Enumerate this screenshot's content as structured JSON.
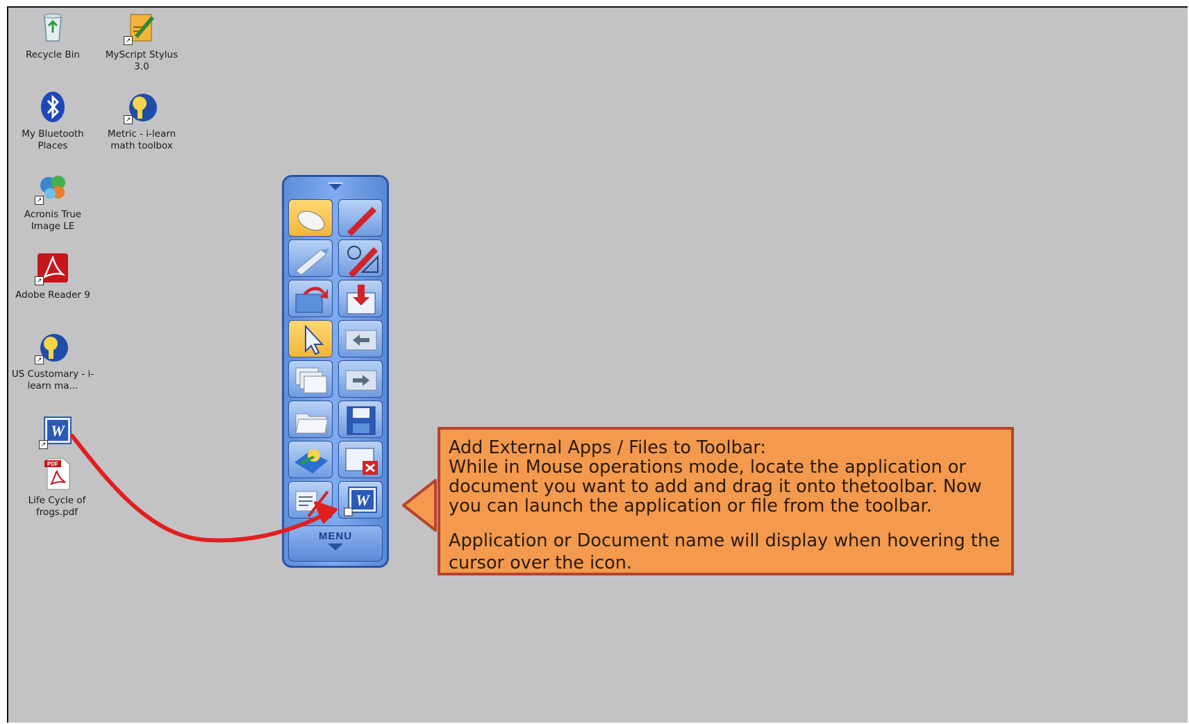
{
  "desktop": {
    "icons": [
      {
        "label": "Recycle Bin",
        "icon": "recycle-bin-icon"
      },
      {
        "label": "MyScript Stylus 3.0",
        "icon": "myscript-stylus-icon"
      },
      {
        "label": "My Bluetooth Places",
        "icon": "bluetooth-icon"
      },
      {
        "label": "Metric - i-learn math toolbox",
        "icon": "ilearn-math-icon"
      },
      {
        "label": "Acronis True Image LE",
        "icon": "acronis-icon"
      },
      {
        "label": "Adobe Reader 9",
        "icon": "adobe-reader-icon"
      },
      {
        "label": "US Customary - i-learn ma...",
        "icon": "ilearn-math-icon"
      },
      {
        "label": "",
        "icon": "word-document-icon"
      },
      {
        "label": "Life Cycle of frogs.pdf",
        "icon": "pdf-file-icon"
      }
    ]
  },
  "toolbar": {
    "menu_label": "MENU",
    "buttons": [
      {
        "icon": "mouse-icon"
      },
      {
        "icon": "pen-icon"
      },
      {
        "icon": "highlighter-icon"
      },
      {
        "icon": "pen-shape-icon"
      },
      {
        "icon": "open-file-icon"
      },
      {
        "icon": "import-icon"
      },
      {
        "icon": "pointer-icon"
      },
      {
        "icon": "back-arrow-icon"
      },
      {
        "icon": "pages-icon"
      },
      {
        "icon": "forward-arrow-icon"
      },
      {
        "icon": "folder-icon"
      },
      {
        "icon": "save-icon"
      },
      {
        "icon": "app-icon"
      },
      {
        "icon": "close-window-icon"
      },
      {
        "icon": "eraser-icon"
      },
      {
        "icon": "word-shortcut-icon"
      }
    ]
  },
  "callout": {
    "title": "Add External Apps / Files to Toolbar:",
    "body": "While in Mouse operations mode, locate the application or document you want to add and drag it onto thetoolbar. Now you can launch the application or file from the toolbar.",
    "note": "Application or Document name will display when hovering the cursor over the icon.",
    "fill_color": "#f39a4e",
    "border_color": "#b8432c"
  },
  "annotation": {
    "arrow_color": "#e02020"
  }
}
